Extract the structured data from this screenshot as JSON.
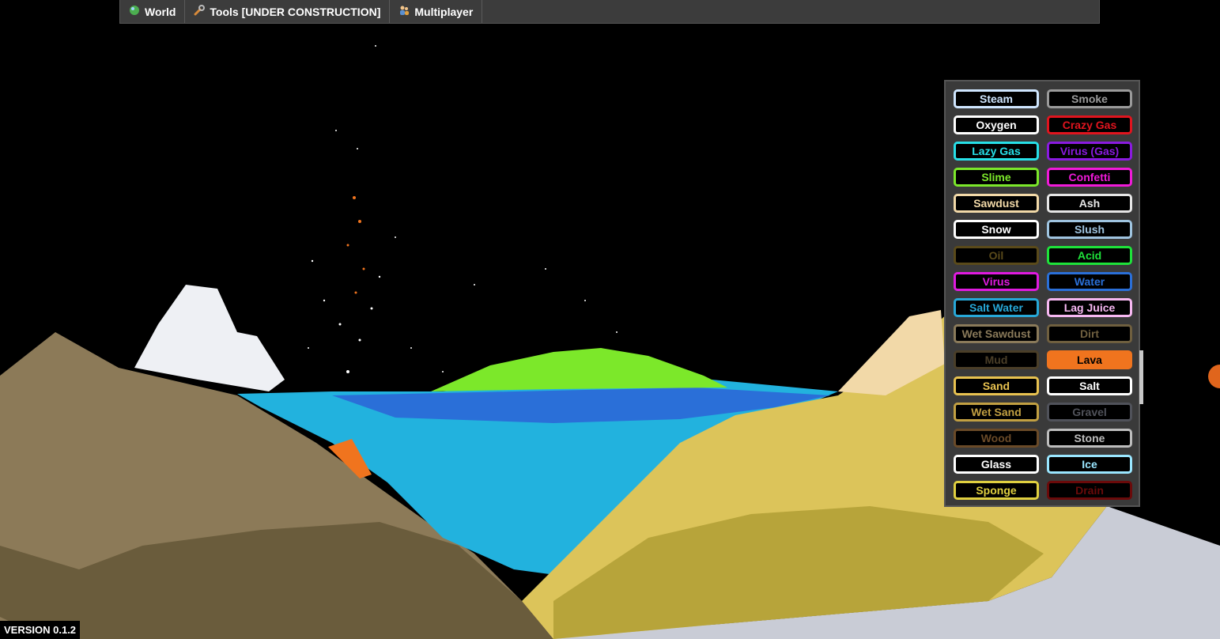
{
  "menu": [
    {
      "label": "World",
      "icon": "globe-icon",
      "color": "#4caf50"
    },
    {
      "label": "Tools [UNDER CONSTRUCTION]",
      "icon": "wrench-icon",
      "color": "#d88a3a"
    },
    {
      "label": "Multiplayer",
      "icon": "people-icon",
      "color": "#5a8fd0"
    }
  ],
  "elements": [
    {
      "label": "Steam",
      "color": "#cfe6ff"
    },
    {
      "label": "Smoke",
      "color": "#9a9a9a"
    },
    {
      "label": "Oxygen",
      "color": "#ffffff"
    },
    {
      "label": "Crazy Gas",
      "color": "#e0141e"
    },
    {
      "label": "Lazy Gas",
      "color": "#27e0e8"
    },
    {
      "label": "Virus (Gas)",
      "color": "#8a1ae0"
    },
    {
      "label": "Slime",
      "color": "#7ce82a"
    },
    {
      "label": "Confetti",
      "color": "#f01ad8"
    },
    {
      "label": "Sawdust",
      "color": "#f2d9a8"
    },
    {
      "label": "Ash",
      "color": "#e6e6e6"
    },
    {
      "label": "Snow",
      "color": "#ffffff"
    },
    {
      "label": "Slush",
      "color": "#9fc4e0"
    },
    {
      "label": "Oil",
      "color": "#5a4a1a"
    },
    {
      "label": "Acid",
      "color": "#1ee23a"
    },
    {
      "label": "Virus",
      "color": "#e01ae0"
    },
    {
      "label": "Water",
      "color": "#2a6fd8"
    },
    {
      "label": "Salt Water",
      "color": "#27a8d8"
    },
    {
      "label": "Lag Juice",
      "color": "#f7b8f2"
    },
    {
      "label": "Wet Sawdust",
      "color": "#8a7a5a"
    },
    {
      "label": "Dirt",
      "color": "#6f5f3f"
    },
    {
      "label": "Mud",
      "color": "#4a3e28"
    },
    {
      "label": "Lava",
      "color": "#f0741e",
      "filled": true
    },
    {
      "label": "Sand",
      "color": "#e8c250"
    },
    {
      "label": "Salt",
      "color": "#ffffff"
    },
    {
      "label": "Wet Sand",
      "color": "#c2a042"
    },
    {
      "label": "Gravel",
      "color": "#50525a"
    },
    {
      "label": "Wood",
      "color": "#6a4a28"
    },
    {
      "label": "Stone",
      "color": "#bdbdbd"
    },
    {
      "label": "Glass",
      "color": "#ffffff"
    },
    {
      "label": "Ice",
      "color": "#9ae6ff"
    },
    {
      "label": "Sponge",
      "color": "#e0d040"
    },
    {
      "label": "Drain",
      "color": "#6a0a0a"
    }
  ],
  "version": "VERSION 0.1.2"
}
